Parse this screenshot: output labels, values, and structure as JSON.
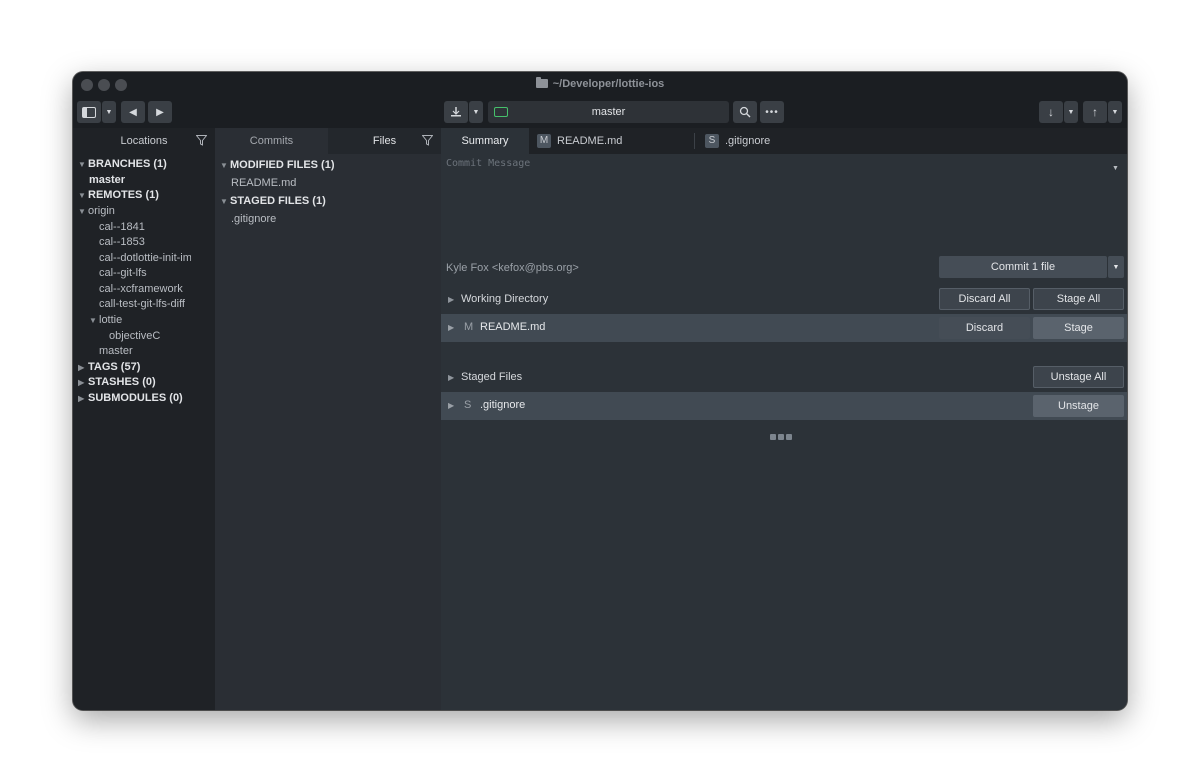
{
  "window": {
    "title": "~/Developer/lottie-ios"
  },
  "toolbar": {
    "branch": "master"
  },
  "locations": {
    "header": "Locations",
    "branches_label": "BRANCHES (1)",
    "branches": [
      "master"
    ],
    "remotes_label": "REMOTES (1)",
    "remote_name": "origin",
    "remote_branches": [
      "cal--1841",
      "cal--1853",
      "cal--dotlottie-init-implementation",
      "cal--git-lfs",
      "cal--xcframework",
      "call-test-git-lfs-diff"
    ],
    "lottie_folder": "lottie",
    "lottie_children": [
      "objectiveC"
    ],
    "remote_master": "master",
    "tags_label": "TAGS (57)",
    "stashes_label": "STASHES (0)",
    "submodules_label": "SUBMODULES (0)"
  },
  "middle": {
    "tab_commits": "Commits",
    "tab_files": "Files",
    "modified_label": "MODIFIED FILES (1)",
    "modified_files": [
      "README.md"
    ],
    "staged_label": "STAGED FILES (1)",
    "staged_files": [
      ".gitignore"
    ]
  },
  "right": {
    "tabs": [
      "Summary",
      "README.md",
      ".gitignore"
    ],
    "tab_badges": [
      "M",
      "S"
    ],
    "commit_placeholder": "Commit Message",
    "author": "Kyle Fox <kefox@pbs.org>",
    "commit_button": "Commit 1 file",
    "working_dir_label": "Working Directory",
    "discard_all": "Discard All",
    "stage_all": "Stage All",
    "wd_file": {
      "status": "M",
      "name": "README.md",
      "discard": "Discard",
      "stage": "Stage"
    },
    "staged_label": "Staged Files",
    "unstage_all": "Unstage All",
    "staged_file": {
      "status": "S",
      "name": ".gitignore",
      "unstage": "Unstage"
    }
  }
}
